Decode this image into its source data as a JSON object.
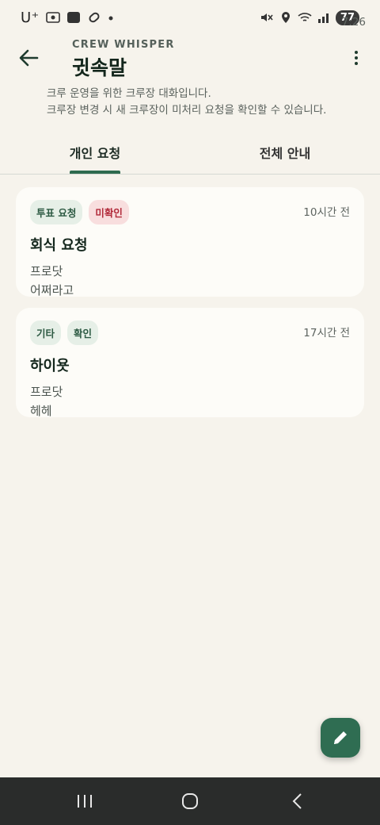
{
  "status_bar": {
    "carrier": "U⁺",
    "time": "7:26",
    "battery": "77"
  },
  "header": {
    "eyebrow": "CREW WHISPER",
    "title": "귓속말",
    "description_line1": "크루 운영을 위한 크루장 대화입니다.",
    "description_line2": "크루장 변경 시 새 크루장이 미처리 요청을 확인할 수 있습니다."
  },
  "tabs": [
    {
      "label": "개인 요청",
      "active": true
    },
    {
      "label": "전체 안내",
      "active": false
    }
  ],
  "messages": [
    {
      "chips": [
        {
          "label": "투표 요청",
          "tone": "green"
        },
        {
          "label": "미확인",
          "tone": "red"
        }
      ],
      "time": "10시간 전",
      "title": "회식 요청",
      "author": "프로닷",
      "body": "어쩌라고"
    },
    {
      "chips": [
        {
          "label": "기타",
          "tone": "green"
        },
        {
          "label": "확인",
          "tone": "green"
        }
      ],
      "time": "17시간 전",
      "title": "하이욧",
      "author": "프로닷",
      "body": "헤헤"
    }
  ],
  "icons": {
    "back": "arrow-left-icon",
    "more": "more-vert-icon",
    "fab": "edit-pencil-icon"
  },
  "colors": {
    "background": "#f6f3ec",
    "accent": "#2f6d52",
    "unread": "#b12a3a"
  }
}
